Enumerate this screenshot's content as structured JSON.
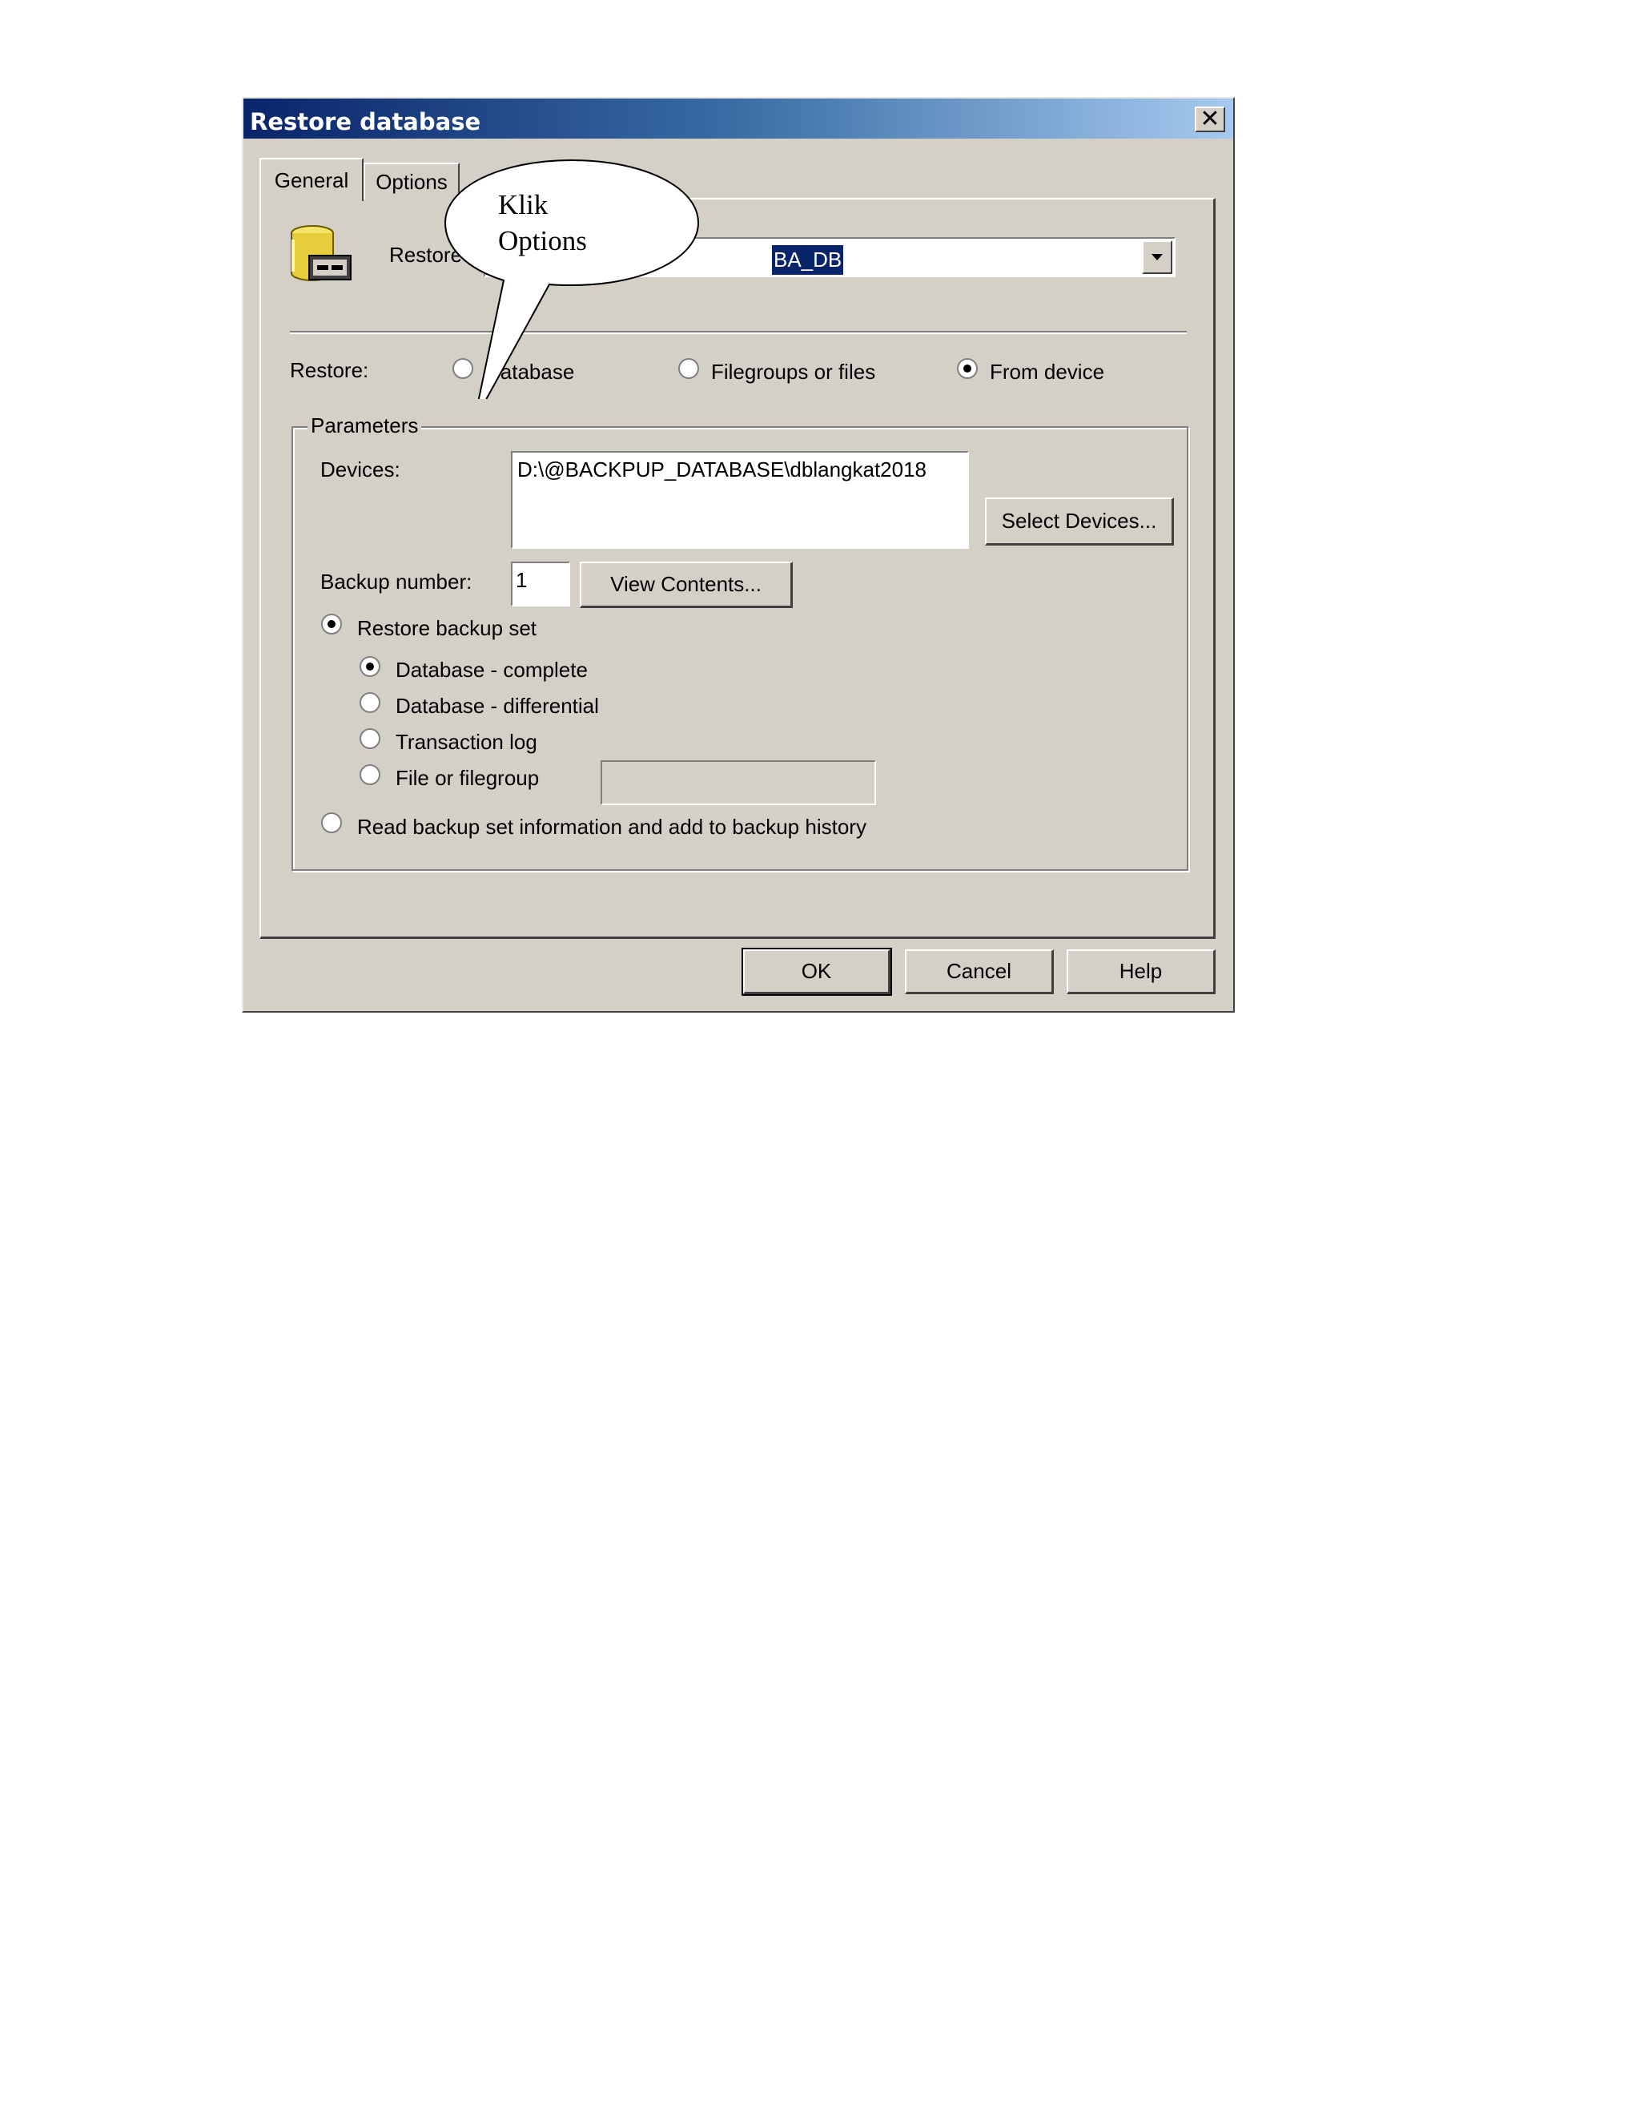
{
  "window": {
    "title": "Restore database",
    "close_glyph": "✕"
  },
  "tabs": [
    {
      "label": "General",
      "selected": true
    },
    {
      "label": "Options",
      "selected": false
    }
  ],
  "header": {
    "icon": "database-icon",
    "restore_as_label": "Restore",
    "combo_value": "BA_DB"
  },
  "restore": {
    "label": "Restore:",
    "options": [
      {
        "label": "Database",
        "checked": false
      },
      {
        "label": "Filegroups or files",
        "checked": false
      },
      {
        "label": "From device",
        "checked": true
      }
    ]
  },
  "parameters": {
    "legend": "Parameters",
    "devices_label": "Devices:",
    "devices": [
      "D:\\@BACKPUP_DATABASE\\dblangkat2018"
    ],
    "select_devices_button": "Select Devices...",
    "backup_number_label": "Backup number:",
    "backup_number_value": "1",
    "view_contents_button": "View Contents...",
    "restore_backup_set": {
      "label": "Restore backup set",
      "checked": true
    },
    "backup_types": [
      {
        "label": "Database - complete",
        "checked": true
      },
      {
        "label": "Database - differential",
        "checked": false
      },
      {
        "label": "Transaction log",
        "checked": false
      },
      {
        "label": "File or filegroup",
        "checked": false
      }
    ],
    "filegroup_value": "",
    "read_backup_info": {
      "label": "Read backup set information and add to backup history",
      "checked": false
    }
  },
  "buttons": {
    "ok": "OK",
    "cancel": "Cancel",
    "help": "Help"
  },
  "callout": {
    "line1": "Klik",
    "line2": "Options"
  },
  "colors": {
    "dialog_bg": "#d4d0c8",
    "title_start": "#0a246a",
    "title_end": "#a6caf0",
    "selection": "#0a246a"
  }
}
